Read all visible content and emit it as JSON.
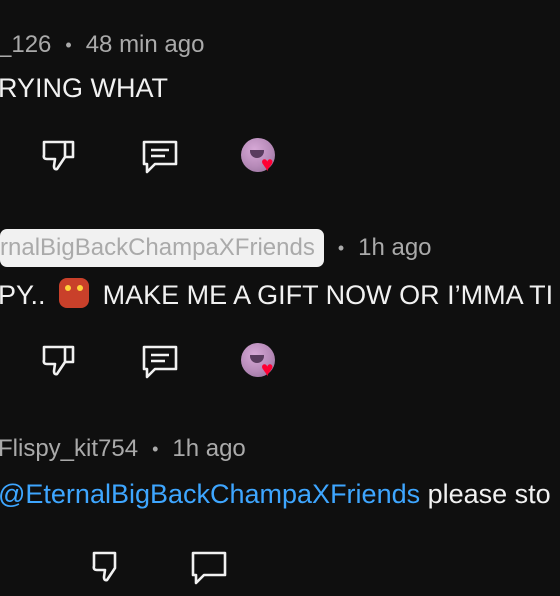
{
  "comments": [
    {
      "user": "_126",
      "time": "48 min ago",
      "text": "RYING WHAT"
    },
    {
      "user": "rnalBigBackChampaXFriends",
      "time": "1h ago",
      "text_before_emoji": "PY..",
      "text_after_emoji": "MAKE ME A GIFT NOW OR I’MMA TI"
    },
    {
      "user": "Flispy_kit754",
      "time": "1h ago",
      "mention": "@EternalBigBackChampaXFriends",
      "text": " please sto"
    }
  ],
  "icons": {
    "dislike": "thumbs-down-icon",
    "reply": "comment-reply-icon",
    "creator_heart": "creator-heart-avatar-icon",
    "emoji": "ogre-emoji-icon"
  },
  "colors": {
    "background": "#0f0f0f",
    "text": "#f1f1f1",
    "meta": "#aaaaaa",
    "mention": "#3ea6ff",
    "heart": "#ff0033"
  }
}
